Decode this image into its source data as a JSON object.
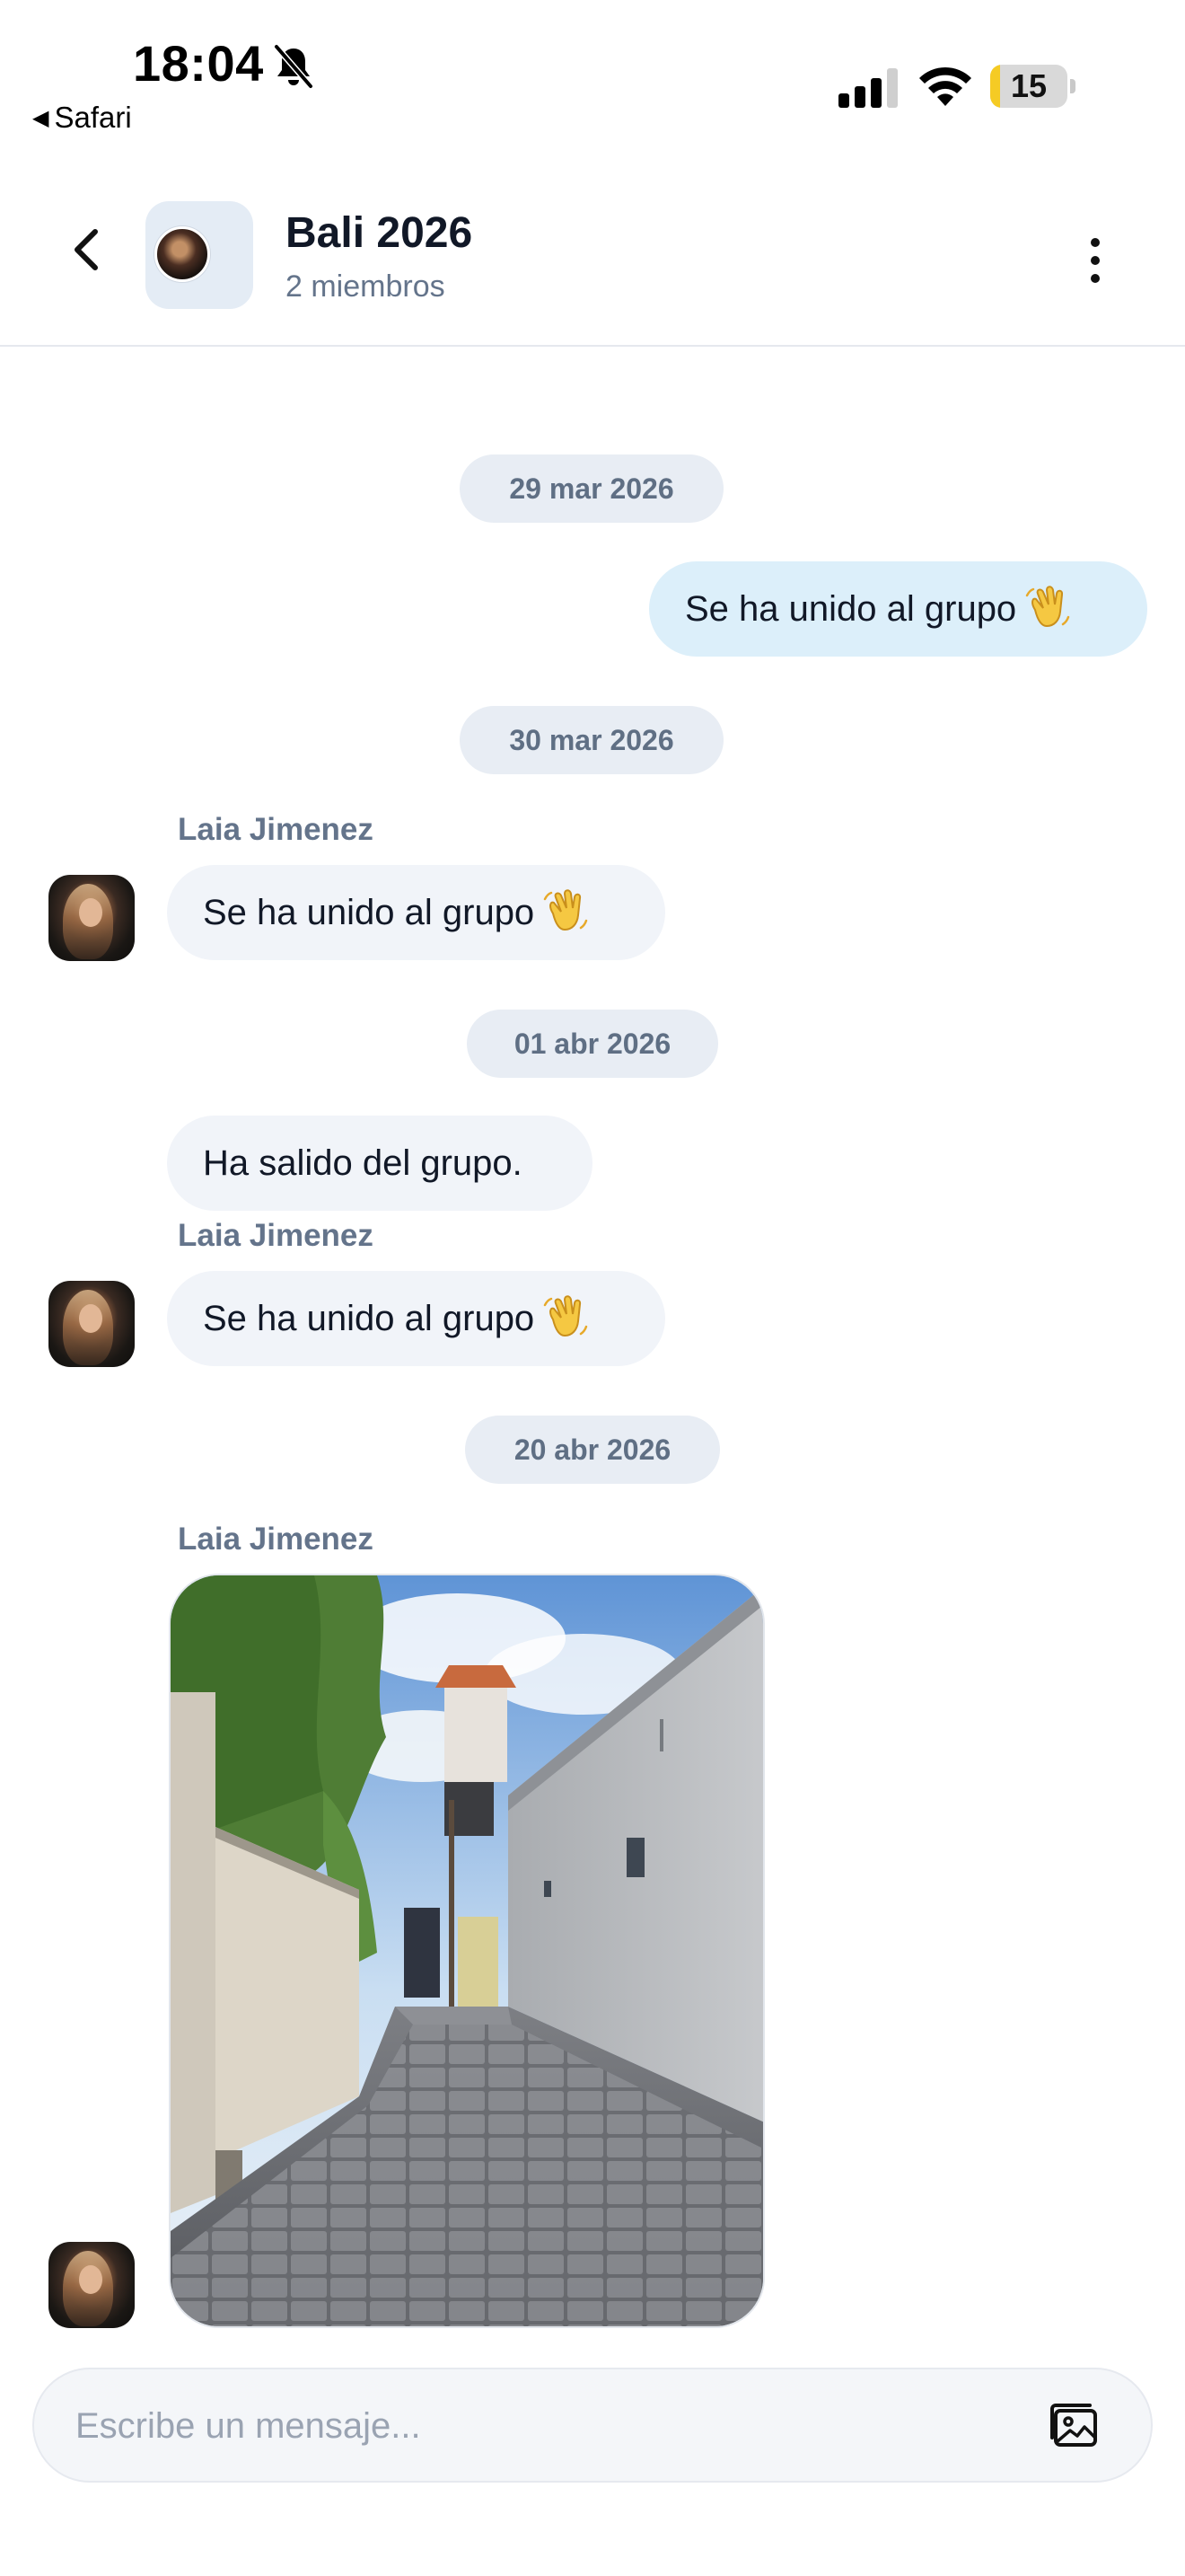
{
  "status_bar": {
    "time": "18:04",
    "back_app": "Safari",
    "battery_percent": 15,
    "battery_label": "15",
    "icons": [
      "bell-slash-icon",
      "cellular-signal-icon",
      "wifi-icon",
      "battery-icon"
    ]
  },
  "header": {
    "title": "Bali 2026",
    "subtitle": "2 miembros",
    "icons": [
      "chevron-left-icon",
      "more-vertical-icon"
    ]
  },
  "messages": {
    "date_1": "29 mar 2026",
    "own_join": "Se ha unido al grupo",
    "date_2": "30 mar 2026",
    "sender_1": "Laia Jimenez",
    "join_1": "Se ha unido al grupo",
    "date_3": "01 abr 2026",
    "left_group": "Ha salido del grupo.",
    "sender_2": "Laia Jimenez",
    "join_2": "Se ha unido al grupo",
    "date_4": "20 abr 2026",
    "sender_3": "Laia Jimenez",
    "emoji_icon": "waving-hand-icon"
  },
  "composer": {
    "placeholder": "Escribe un mensaje...",
    "value": "",
    "icon": "image-icon"
  },
  "colors": {
    "outgoing_bubble": "#dceffa",
    "incoming_bubble": "#f1f4f9",
    "date_chip": "#e8edf4",
    "battery_fill": "#f5cb24",
    "muted_text": "#64748b"
  }
}
